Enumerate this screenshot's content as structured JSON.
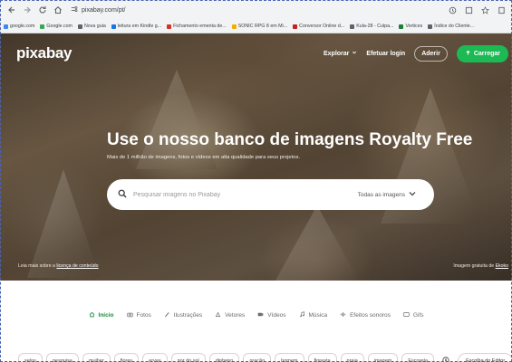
{
  "browser": {
    "url": "pixabay.com/pt/",
    "bookmarks": [
      {
        "label": "google.com",
        "color": "#4285f4"
      },
      {
        "label": "Google.com",
        "color": "#34a853"
      },
      {
        "label": "Nova guia",
        "color": "#5f6368"
      },
      {
        "label": "leitura em Kindle g...",
        "color": "#1a73e8"
      },
      {
        "label": "Fichamento ementa de...",
        "color": "#d93025"
      },
      {
        "label": "SONIC RPG 8 em Mi...",
        "color": "#f9ab00"
      },
      {
        "label": "Conversor Online d...",
        "color": "#c5221f"
      },
      {
        "label": "Kula-28 - Culpa...",
        "color": "#5f6368"
      },
      {
        "label": "Vertices",
        "color": "#188038"
      },
      {
        "label": "Índice do Cliente...",
        "color": "#5f6368"
      }
    ]
  },
  "header": {
    "logo": "pixabay",
    "explore": "Explorar",
    "login": "Efetuar login",
    "join": "Aderir",
    "upload": "Carregar"
  },
  "hero": {
    "title": "Use o nosso banco de imagens Royalty Free",
    "subtitle": "Mais de 1 milhão de imagens, fotos e vídeos em alta qualidade para seus projetos.",
    "search_placeholder": "Pesquisar imagens no Pixabay",
    "search_filter": "Todas as imagens",
    "credit_prefix": "Leia mais sobre a",
    "credit_link": "licença de conteúdo",
    "credit_right_prefix": "Imagem gratuita de",
    "credit_right_link": "Ekoko"
  },
  "categories": [
    {
      "label": "Início",
      "icon": "home-icon",
      "active": true
    },
    {
      "label": "Fotos",
      "icon": "camera-icon",
      "active": false
    },
    {
      "label": "Ilustrações",
      "icon": "brush-icon",
      "active": false
    },
    {
      "label": "Vetores",
      "icon": "vector-icon",
      "active": false
    },
    {
      "label": "Vídeos",
      "icon": "video-icon",
      "active": false
    },
    {
      "label": "Música",
      "icon": "music-icon",
      "active": false
    },
    {
      "label": "Efeitos sonoros",
      "icon": "sound-wave-icon",
      "active": false
    },
    {
      "label": "Gifs",
      "icon": "gif-icon",
      "active": false
    }
  ],
  "tags": [
    "selos",
    "pesquisa",
    "mulher",
    "flores",
    "ervas",
    "por do sol",
    "dinheiro",
    "oração",
    "homem",
    "floresta",
    "praia",
    "imagem",
    "Escoreta"
  ],
  "editor_choice": "Escolha do Editor",
  "colors": {
    "accent_green": "#1db954",
    "active_tab": "#1b8a3e"
  }
}
